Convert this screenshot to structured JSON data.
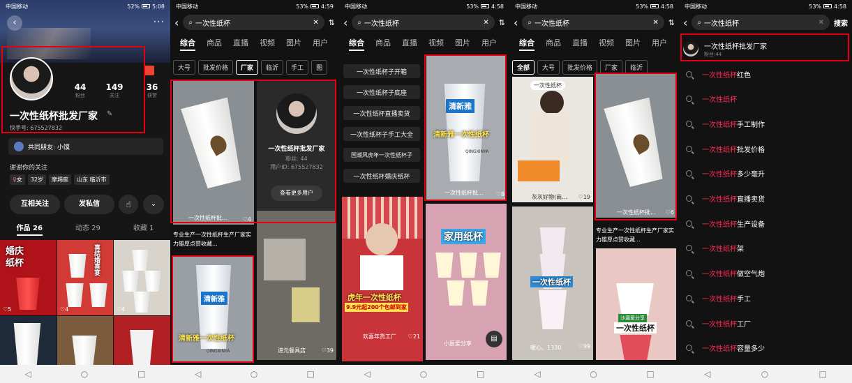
{
  "status": {
    "p1": {
      "carrier": "中国移动",
      "battery": "52%",
      "time": "5:08"
    },
    "p2": {
      "carrier": "中国移动",
      "battery": "53%",
      "time": "4:59"
    },
    "p3": {
      "carrier": "中国移动",
      "battery": "53%",
      "time": "4:58"
    },
    "p4": {
      "carrier": "中国移动",
      "battery": "53%",
      "time": "4:58"
    },
    "p5": {
      "carrier": "中国移动",
      "battery": "53%",
      "time": "4:58"
    }
  },
  "profile": {
    "name": "一次性纸杯批发厂家",
    "kuaishou_id": "快手号: 675527832",
    "stats": [
      {
        "value": "44",
        "label": "粉丝"
      },
      {
        "value": "149",
        "label": "关注"
      },
      {
        "value": "36",
        "label": "获赞"
      }
    ],
    "mutual_label": "共同朋友: 小馍",
    "thanks": "谢谢你的关注",
    "tags": [
      "女",
      "32岁",
      "摩羯座",
      "山东 临沂市"
    ],
    "buttons": {
      "follow_back": "互相关注",
      "message": "发私信"
    },
    "tabs": [
      "作品 26",
      "动态 29",
      "收藏 1"
    ],
    "grid_likes": [
      "5",
      "4",
      "4"
    ],
    "grid_text": [
      "婚庆",
      "纸杯",
      "喜结",
      "婚喜",
      "宴"
    ]
  },
  "search": {
    "query": "一次性纸杯",
    "search_button": "搜索",
    "tabs": [
      "综合",
      "商品",
      "直播",
      "视频",
      "图片",
      "用户"
    ],
    "chips_p2": [
      "大号",
      "批发价格",
      "厂家",
      "临沂",
      "手工",
      "图"
    ],
    "chips_p4": [
      "全部",
      "大号",
      "批发价格",
      "厂家",
      "临沂"
    ]
  },
  "panel2": {
    "user_card": {
      "name": "一次性纸杯批发厂家",
      "fans": "粉丝: 44",
      "user_id": "用户ID: 675527832",
      "more": "查看更多用户"
    },
    "tile1_caption": "一次性纸杯批...",
    "tile1_likes": "4",
    "desc": "专业生产一次性纸杯生产厂家实力雄厚点赞收藏...",
    "brand": "清新雅",
    "promo": "清新雅一次性纸杯",
    "qing": "QINGXINYA",
    "shop": "进元餐具店",
    "shop_likes": "39"
  },
  "panel3": {
    "suggestions": [
      "一次性纸杯子开箱",
      "一次性纸杯子底座",
      "一次性纸杯直播卖货",
      "一次性纸杯子手工大全",
      "国潮风虎年一次性纸杯子",
      "一次性纸杯婚庆纸杯"
    ],
    "right_tile": {
      "brand": "清新雅",
      "promo": "清新雅一次性纸杯",
      "qing": "QINGXINYA",
      "caption": "一次性纸杯批...",
      "likes": "8"
    },
    "left_tile": {
      "line1": "虎年一次性纸杯",
      "line2": "9.9元起200个包邮到家",
      "user": "欢喜年货工厂",
      "likes": "21"
    },
    "home_tile": {
      "title": "家用纸杯",
      "user": "小厨爱分享"
    }
  },
  "panel4": {
    "tile_tag": "一次性纸杯",
    "left_user": "灰灰好物(商...",
    "left_likes": "19",
    "right_caption": "一次性纸杯批...",
    "right_likes": "6",
    "desc": "专业生产一次性纸杯生产厂家实力雄厚点赞收藏...",
    "cup_tile": "一次性纸杯",
    "cup_user": "暖心。1330",
    "cup_likes": "99",
    "share_tag": "沙漏爱分享",
    "share_text": "一次性纸杯"
  },
  "panel5": {
    "top_user": {
      "name": "一次性纸杯批发厂家",
      "fans": "粉丝:44"
    },
    "history": [
      {
        "hl": "一次性纸杯",
        "rest": "红色"
      },
      {
        "hl": "一次性纸杯",
        "rest": ""
      },
      {
        "hl": "一次性纸杯",
        "rest": "手工制作"
      },
      {
        "hl": "一次性纸杯",
        "rest": "批发价格"
      },
      {
        "hl": "一次性纸杯",
        "rest": "多少毫升"
      },
      {
        "hl": "一次性纸杯",
        "rest": "直播卖货"
      },
      {
        "hl": "一次性纸杯",
        "rest": "生产设备"
      },
      {
        "hl": "一次性纸杯",
        "rest": "架"
      },
      {
        "hl": "一次性纸杯",
        "rest": "做空气炮"
      },
      {
        "hl": "一次性纸杯",
        "rest": "手工"
      },
      {
        "hl": "一次性纸杯",
        "rest": "工厂"
      },
      {
        "hl": "一次性纸杯",
        "rest": "容量多少"
      }
    ]
  },
  "colors": {
    "accent": "#ff2c55",
    "highlight_box": "#e60012",
    "promo_yellow": "#ffe34d"
  }
}
